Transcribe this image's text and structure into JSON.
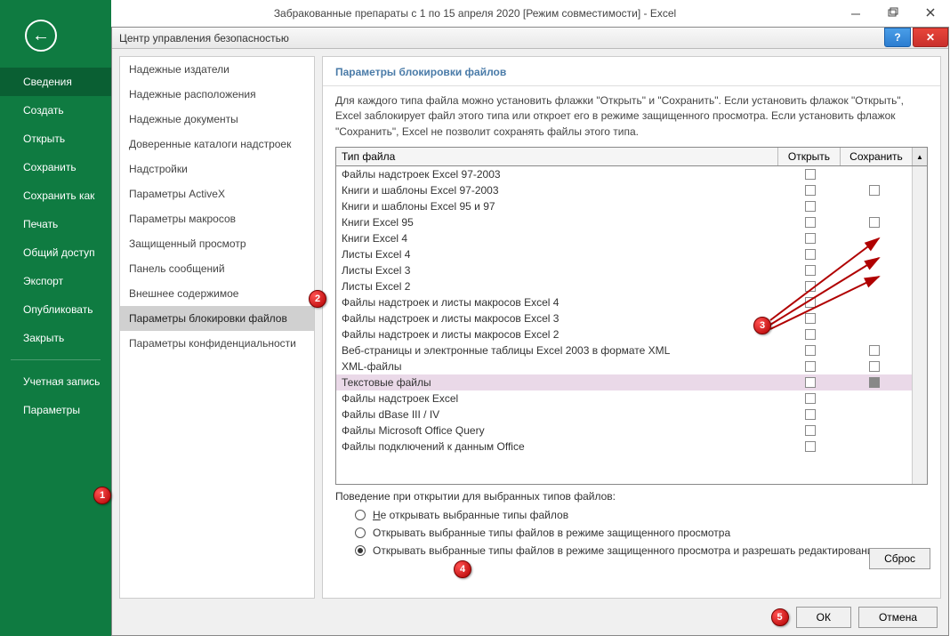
{
  "window": {
    "title": "Забракованные препараты с 1 по 15 апреля 2020  [Режим совместимости] - Excel"
  },
  "sidebar": {
    "items": [
      "Сведения",
      "Создать",
      "Открыть",
      "Сохранить",
      "Сохранить как",
      "Печать",
      "Общий доступ",
      "Экспорт",
      "Опубликовать",
      "Закрыть"
    ],
    "items2": [
      "Учетная запись",
      "Параметры"
    ]
  },
  "dialog": {
    "title": "Центр управления безопасностью",
    "categories": [
      "Надежные издатели",
      "Надежные расположения",
      "Надежные документы",
      "Доверенные каталоги надстроек",
      "Надстройки",
      "Параметры ActiveX",
      "Параметры макросов",
      "Защищенный просмотр",
      "Панель сообщений",
      "Внешнее содержимое",
      "Параметры блокировки файлов",
      "Параметры конфиденциальности"
    ],
    "selected_category_index": 10,
    "section_header": "Параметры блокировки файлов",
    "section_desc": "Для каждого типа файла можно установить флажки \"Открыть\" и \"Сохранить\". Если установить флажок \"Открыть\", Excel заблокирует файл этого типа или откроет его в режиме защищенного просмотра. Если установить флажок \"Сохранить\", Excel не позволит сохранять файлы этого типа.",
    "columns": {
      "type": "Тип файла",
      "open": "Открыть",
      "save": "Сохранить"
    },
    "rows": [
      {
        "label": "Файлы надстроек Excel 97-2003",
        "open": true,
        "save": false,
        "save_enabled": false
      },
      {
        "label": "Книги и шаблоны Excel 97-2003",
        "open": true,
        "save": true
      },
      {
        "label": "Книги и шаблоны Excel 95 и 97",
        "open": true,
        "save": false,
        "save_enabled": false
      },
      {
        "label": "Книги Excel 95",
        "open": true,
        "save": true
      },
      {
        "label": "Книги Excel 4",
        "open": true,
        "save": false,
        "save_enabled": false
      },
      {
        "label": "Листы Excel 4",
        "open": true,
        "save": false,
        "save_enabled": false
      },
      {
        "label": "Листы Excel 3",
        "open": true,
        "save": false,
        "save_enabled": false
      },
      {
        "label": "Листы Excel 2",
        "open": true,
        "save": false,
        "save_enabled": false
      },
      {
        "label": "Файлы надстроек и листы макросов Excel 4",
        "open": true,
        "save": false,
        "save_enabled": false
      },
      {
        "label": "Файлы надстроек и листы макросов Excel 3",
        "open": true,
        "save": false,
        "save_enabled": false
      },
      {
        "label": "Файлы надстроек и листы макросов Excel 2",
        "open": true,
        "save": false,
        "save_enabled": false
      },
      {
        "label": "Веб-страницы и электронные таблицы Excel 2003 в формате XML",
        "open": true,
        "save": true
      },
      {
        "label": "XML-файлы",
        "open": true,
        "save": true
      },
      {
        "label": "Текстовые файлы",
        "open": true,
        "save": true,
        "highlight": true,
        "save_filled": true
      },
      {
        "label": "Файлы надстроек Excel",
        "open": true,
        "save": false,
        "save_enabled": false
      },
      {
        "label": "Файлы dBase III / IV",
        "open": true,
        "save": false,
        "save_enabled": false
      },
      {
        "label": "Файлы Microsoft Office Query",
        "open": true,
        "save": false,
        "save_enabled": false
      },
      {
        "label": "Файлы подключений к данным Office",
        "open": true,
        "save": false,
        "save_enabled": false
      }
    ],
    "behavior_label": "Поведение при открытии для выбранных типов файлов:",
    "behavior_options": [
      {
        "label_pre": "",
        "underline": "Н",
        "label_post": "е открывать выбранные типы файлов",
        "checked": false
      },
      {
        "label_pre": "Открывать выбранные типы файлов в режиме защищенного просмотра",
        "checked": false
      },
      {
        "label_pre": "Открывать выбранные типы файлов в режиме защищенного просмотра и разрешать редактирование",
        "checked": true
      }
    ],
    "reset_label": "Сброс",
    "ok_label": "ОК",
    "cancel_label": "Отмена"
  },
  "annotations": {
    "b1": "1",
    "b2": "2",
    "b3": "3",
    "b4": "4",
    "b5": "5"
  }
}
